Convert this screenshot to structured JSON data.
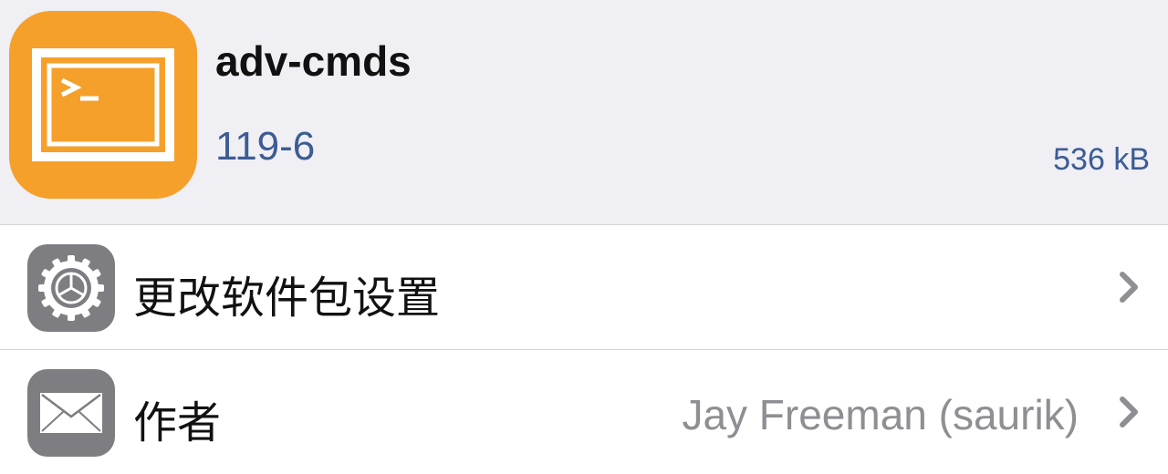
{
  "package": {
    "name": "adv-cmds",
    "version": "119-6",
    "size": "536 kB",
    "icon": "terminal-icon",
    "icon_color": "#f5a02a"
  },
  "rows": [
    {
      "label": "更改软件包设置",
      "value": "",
      "icon": "gear-icon"
    },
    {
      "label": "作者",
      "value": "Jay Freeman (saurik)",
      "icon": "mail-icon"
    }
  ],
  "colors": {
    "link": "#3c5c94",
    "secondary_text": "#8e8e93",
    "row_icon_bg": "#7d7d82",
    "header_bg": "#efeff4"
  }
}
